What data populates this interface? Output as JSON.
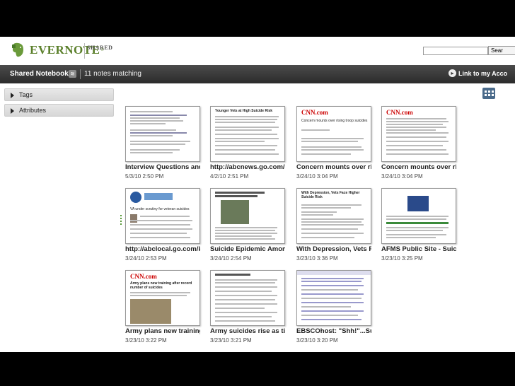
{
  "header": {
    "logo_text": "EVERNOTE",
    "logo_reg": "®",
    "shared_tag": "SHARED",
    "search_placeholder": "",
    "search_button": "Sear"
  },
  "notebook_bar": {
    "title": "Shared Notebook",
    "count": "11 notes matching",
    "link_label": "Link to my Acco"
  },
  "sidebar": {
    "items": [
      {
        "label": "Tags"
      },
      {
        "label": "Attributes"
      }
    ]
  },
  "notes": [
    {
      "title": "Interview Questions and",
      "date": "5/3/10 2:50 PM"
    },
    {
      "title": "http://abcnews.go.com/H",
      "date": "4/2/10 2:51 PM"
    },
    {
      "title": "Concern mounts over risi",
      "date": "3/24/10 3:04 PM"
    },
    {
      "title": "Concern mounts over risi",
      "date": "3/24/10 3:04 PM"
    },
    {
      "title": "http://abclocal.go.com/kg",
      "date": "3/24/10 2:53 PM"
    },
    {
      "title": "Suicide Epidemic Among",
      "date": "3/24/10 2:54 PM"
    },
    {
      "title": "With Depression, Vets Fa",
      "date": "3/23/10 3:36 PM"
    },
    {
      "title": "AFMS Public Site - Suicid",
      "date": "3/23/10 3:25 PM"
    },
    {
      "title": "Army plans new training",
      "date": "3/23/10 3:22 PM"
    },
    {
      "title": "Army suicides rise as tin",
      "date": "3/23/10 3:21 PM"
    },
    {
      "title": "EBSCOhost: \"Shh!\"...Suic",
      "date": "3/23/10 3:20 PM"
    }
  ],
  "thumb_text": {
    "t2_head": "Younger Vets at High Suicide Risk",
    "t3_logo": "CNN.com",
    "t3_head": "Concern mounts over rising troop suicides",
    "t4_logo": "CNN.com",
    "t5_head": "VA under scrutiny for veteran suicides",
    "t7_head": "With Depression, Vets Face Higher Suicide Risk",
    "t9_logo": "CNN.com",
    "t9_head": "Army plans new training after record number of suicides"
  }
}
